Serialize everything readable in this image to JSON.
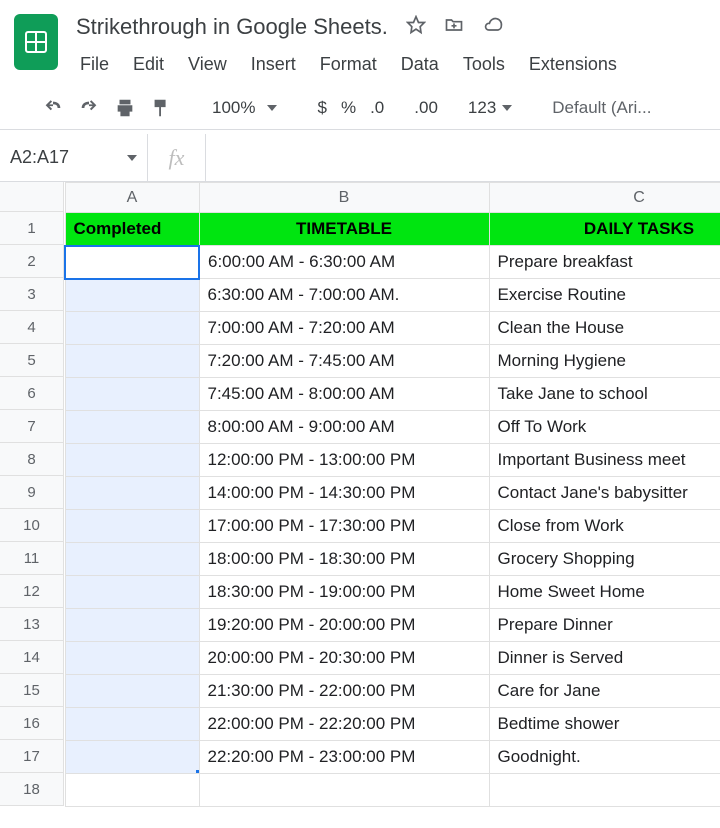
{
  "header": {
    "title": "Strikethrough in Google Sheets.",
    "icons": {
      "star": "star-icon",
      "move": "move-folder-icon",
      "cloud": "cloud-status-icon"
    }
  },
  "menubar": [
    "File",
    "Edit",
    "View",
    "Insert",
    "Format",
    "Data",
    "Tools",
    "Extensions"
  ],
  "toolbar": {
    "zoom": "100%",
    "currency": "$",
    "percent": "%",
    "dec_dec": ".0",
    "inc_dec": ".00",
    "more_fmt": "123",
    "font": "Default (Ari..."
  },
  "namebox": "A2:A17",
  "fx_value": "",
  "columns": [
    "A",
    "B",
    "C"
  ],
  "rows": [
    1,
    2,
    3,
    4,
    5,
    6,
    7,
    8,
    9,
    10,
    11,
    12,
    13,
    14,
    15,
    16,
    17,
    18
  ],
  "sheet": {
    "header_row": {
      "a": "Completed",
      "b": "TIMETABLE",
      "c": "DAILY TASKS"
    },
    "data": [
      {
        "a": "",
        "b": "6:00:00 AM - 6:30:00 AM",
        "c": "Prepare breakfast"
      },
      {
        "a": "",
        "b": "6:30:00 AM - 7:00:00 AM.",
        "c": "Exercise Routine"
      },
      {
        "a": "",
        "b": "7:00:00 AM - 7:20:00 AM",
        "c": "Clean the House"
      },
      {
        "a": "",
        "b": "7:20:00 AM - 7:45:00 AM",
        "c": "Morning Hygiene"
      },
      {
        "a": "",
        "b": "7:45:00 AM - 8:00:00 AM",
        "c": "Take Jane to school"
      },
      {
        "a": "",
        "b": "8:00:00 AM - 9:00:00 AM",
        "c": "Off To Work"
      },
      {
        "a": "",
        "b": "12:00:00 PM - 13:00:00 PM",
        "c": "Important Business meet"
      },
      {
        "a": "",
        "b": "14:00:00 PM - 14:30:00 PM",
        "c": "Contact Jane's babysitter"
      },
      {
        "a": "",
        "b": "17:00:00 PM - 17:30:00 PM",
        "c": "Close from Work"
      },
      {
        "a": "",
        "b": "18:00:00 PM - 18:30:00 PM",
        "c": "Grocery Shopping"
      },
      {
        "a": "",
        "b": "18:30:00 PM - 19:00:00 PM",
        "c": "Home Sweet Home"
      },
      {
        "a": "",
        "b": "19:20:00 PM - 20:00:00 PM",
        "c": "Prepare Dinner"
      },
      {
        "a": "",
        "b": "20:00:00 PM - 20:30:00 PM",
        "c": "Dinner is Served"
      },
      {
        "a": "",
        "b": "21:30:00 PM - 22:00:00 PM",
        "c": "Care for Jane"
      },
      {
        "a": "",
        "b": "22:00:00 PM - 22:20:00 PM",
        "c": "Bedtime shower"
      },
      {
        "a": "",
        "b": "22:20:00 PM - 23:00:00 PM",
        "c": "Goodnight."
      }
    ]
  }
}
